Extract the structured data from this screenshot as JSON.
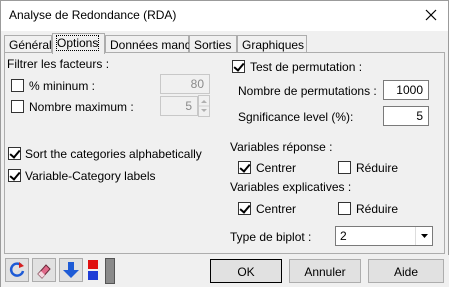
{
  "window": {
    "title": "Analyse de Redondance (RDA)"
  },
  "tabs": [
    {
      "label": "Général",
      "active": false
    },
    {
      "label": "Options",
      "active": true
    },
    {
      "label": "Données manq.",
      "active": false
    },
    {
      "label": "Sorties",
      "active": false
    },
    {
      "label": "Graphiques",
      "active": false
    }
  ],
  "filter": {
    "heading": "Filtrer les facteurs :",
    "pct_min_label": "% mininum :",
    "pct_min_checked": false,
    "pct_min_value": "80",
    "max_label": "Nombre maximum :",
    "max_checked": false,
    "max_value": "5"
  },
  "sort_alpha": {
    "label": "Sort the categories alphabetically",
    "checked": true
  },
  "var_cat_labels": {
    "label": "Variable-Category labels",
    "checked": true
  },
  "permutation": {
    "label": "Test de permutation :",
    "checked": true,
    "nb_label": "Nombre de permutations :",
    "nb_value": "1000",
    "sig_label": "Sgnificance level (%):",
    "sig_value": "5"
  },
  "response_vars": {
    "heading": "Variables réponse :",
    "center_label": "Centrer",
    "center_checked": true,
    "reduce_label": "Réduire",
    "reduce_checked": false
  },
  "explanatory_vars": {
    "heading": "Variables explicatives :",
    "center_label": "Centrer",
    "center_checked": true,
    "reduce_label": "Réduire",
    "reduce_checked": false
  },
  "biplot": {
    "label": "Type de biplot :",
    "value": "2"
  },
  "footer": {
    "ok_label": "OK",
    "cancel_label": "Annuler",
    "help_label": "Aide"
  }
}
